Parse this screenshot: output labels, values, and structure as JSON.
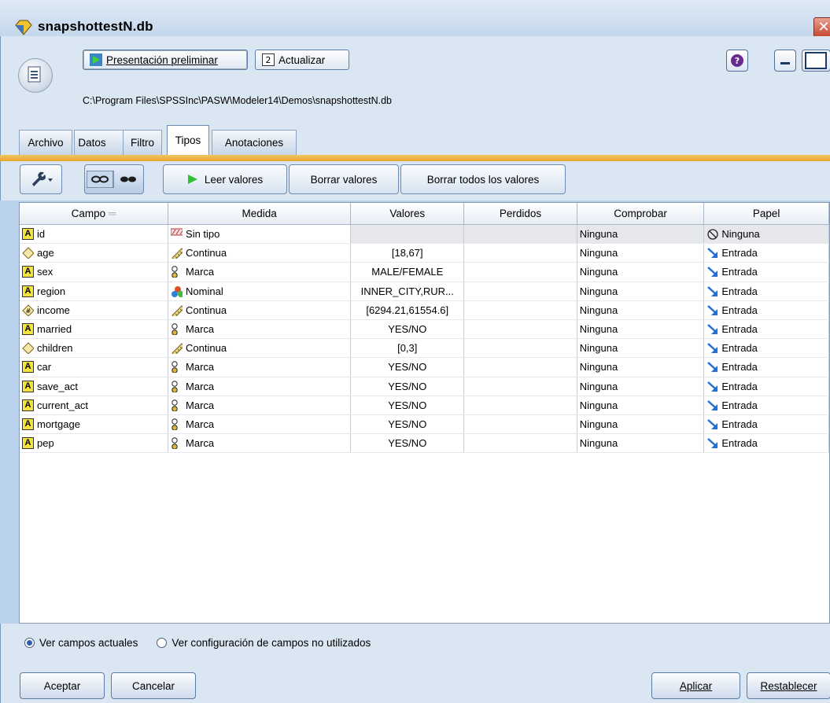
{
  "window": {
    "title": "snapshottestN.db",
    "close_glyph": "✕"
  },
  "header": {
    "preview_label": "Presentación preliminar",
    "update_label": "Actualizar",
    "path": "C:\\Program Files\\SPSSInc\\PASW\\Modeler14\\Demos\\snapshottestN.db",
    "help_glyph": "?"
  },
  "tabs": [
    {
      "label": "Archivo",
      "active": false
    },
    {
      "label": "Datos",
      "active": false
    },
    {
      "label": "Filtro",
      "active": false
    },
    {
      "label": "Tipos",
      "active": true
    },
    {
      "label": "Anotaciones",
      "active": false
    }
  ],
  "toolbar": {
    "read_values": "Leer valores",
    "clear_values": "Borrar valores",
    "clear_all_values": "Borrar todos los valores"
  },
  "table": {
    "headers": [
      "Campo",
      "Medida",
      "Valores",
      "Perdidos",
      "Comprobar",
      "Papel"
    ],
    "rows": [
      {
        "field": "id",
        "field_icon": "string-A-icon",
        "measure": "Sin tipo",
        "measure_icon": "typeless-icon",
        "values": "",
        "missing": "",
        "check": "Ninguna",
        "role": "Ninguna",
        "role_icon": "none-role-icon"
      },
      {
        "field": "age",
        "field_icon": "integer-diamond-icon",
        "measure": "Continua",
        "measure_icon": "ruler-icon",
        "values": "[18,67]",
        "missing": "",
        "check": "Ninguna",
        "role": "Entrada",
        "role_icon": "input-arrow-icon"
      },
      {
        "field": "sex",
        "field_icon": "string-A-icon",
        "measure": "Marca",
        "measure_icon": "flag-icon",
        "values": "MALE/FEMALE",
        "missing": "",
        "check": "Ninguna",
        "role": "Entrada",
        "role_icon": "input-arrow-icon"
      },
      {
        "field": "region",
        "field_icon": "string-A-icon",
        "measure": "Nominal",
        "measure_icon": "nominal-icon",
        "values": "INNER_CITY,RUR...",
        "missing": "",
        "check": "Ninguna",
        "role": "Entrada",
        "role_icon": "input-arrow-icon"
      },
      {
        "field": "income",
        "field_icon": "real-hash-icon",
        "measure": "Continua",
        "measure_icon": "ruler-icon",
        "values": "[6294.21,61554.6]",
        "missing": "",
        "check": "Ninguna",
        "role": "Entrada",
        "role_icon": "input-arrow-icon"
      },
      {
        "field": "married",
        "field_icon": "string-A-icon",
        "measure": "Marca",
        "measure_icon": "flag-icon",
        "values": "YES/NO",
        "missing": "",
        "check": "Ninguna",
        "role": "Entrada",
        "role_icon": "input-arrow-icon"
      },
      {
        "field": "children",
        "field_icon": "integer-diamond-icon",
        "measure": "Continua",
        "measure_icon": "ruler-icon",
        "values": "[0,3]",
        "missing": "",
        "check": "Ninguna",
        "role": "Entrada",
        "role_icon": "input-arrow-icon"
      },
      {
        "field": "car",
        "field_icon": "string-A-icon",
        "measure": "Marca",
        "measure_icon": "flag-icon",
        "values": "YES/NO",
        "missing": "",
        "check": "Ninguna",
        "role": "Entrada",
        "role_icon": "input-arrow-icon"
      },
      {
        "field": "save_act",
        "field_icon": "string-A-icon",
        "measure": "Marca",
        "measure_icon": "flag-icon",
        "values": "YES/NO",
        "missing": "",
        "check": "Ninguna",
        "role": "Entrada",
        "role_icon": "input-arrow-icon"
      },
      {
        "field": "current_act",
        "field_icon": "string-A-icon",
        "measure": "Marca",
        "measure_icon": "flag-icon",
        "values": "YES/NO",
        "missing": "",
        "check": "Ninguna",
        "role": "Entrada",
        "role_icon": "input-arrow-icon"
      },
      {
        "field": "mortgage",
        "field_icon": "string-A-icon",
        "measure": "Marca",
        "measure_icon": "flag-icon",
        "values": "YES/NO",
        "missing": "",
        "check": "Ninguna",
        "role": "Entrada",
        "role_icon": "input-arrow-icon"
      },
      {
        "field": "pep",
        "field_icon": "string-A-icon",
        "measure": "Marca",
        "measure_icon": "flag-icon",
        "values": "YES/NO",
        "missing": "",
        "check": "Ninguna",
        "role": "Entrada",
        "role_icon": "input-arrow-icon"
      }
    ]
  },
  "view_options": [
    {
      "label": "Ver campos actuales",
      "selected": true
    },
    {
      "label": "Ver configuración de campos no utilizados",
      "selected": false
    }
  ],
  "footer": {
    "ok": "Aceptar",
    "cancel": "Cancelar",
    "apply": "Aplicar",
    "reset": "Restablecer"
  },
  "colors": {
    "accent_tab_line": "#e6a52a",
    "frame": "#b9d1ea",
    "panel": "#dbe6f3"
  }
}
